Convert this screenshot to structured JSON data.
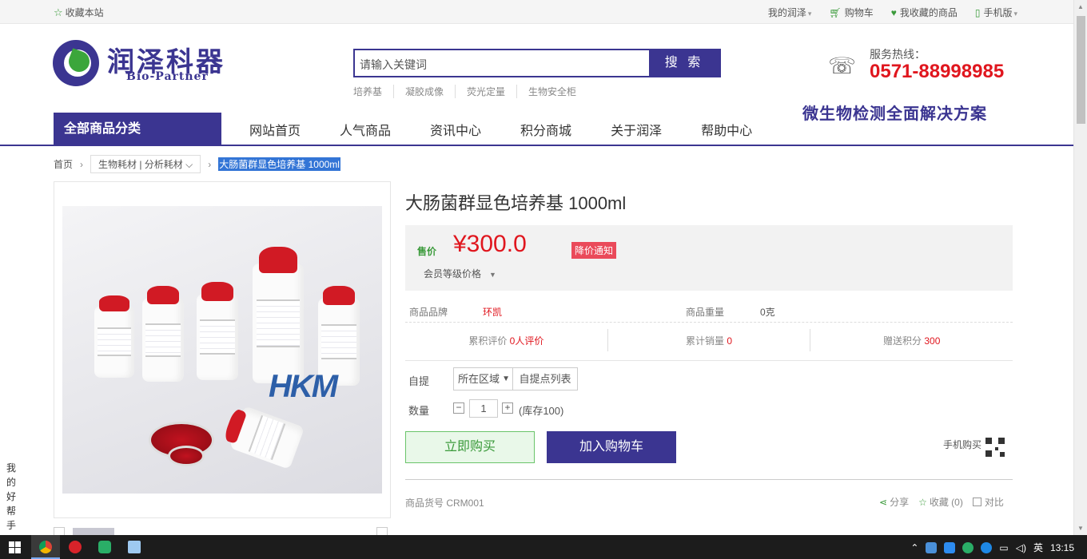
{
  "topbar": {
    "favorite": "收藏本站",
    "links": [
      {
        "label": "我的润泽",
        "icon": "",
        "dropdown": true
      },
      {
        "label": "购物车",
        "icon": "cart-icon",
        "dropdown": false
      },
      {
        "label": "我收藏的商品",
        "icon": "heart-icon",
        "dropdown": false
      },
      {
        "label": "手机版",
        "icon": "phone-icon",
        "dropdown": true
      }
    ]
  },
  "logo": {
    "cn": "润泽科器",
    "en": "Bio-Partner"
  },
  "search": {
    "placeholder": "请输入关键词",
    "button": "搜 索",
    "hot": [
      "培养基",
      "凝胶成像",
      "荧光定量",
      "生物安全柜"
    ]
  },
  "hotline": {
    "label": "服务热线：",
    "number": "0571-88998985"
  },
  "slogan": "微生物检测全面解决方案",
  "nav": {
    "category": "全部商品分类",
    "items": [
      "网站首页",
      "人气商品",
      "资讯中心",
      "积分商城",
      "关于润泽",
      "帮助中心"
    ]
  },
  "breadcrumb": {
    "home": "首页",
    "category": "生物耗材 | 分析耗材",
    "current": "大肠菌群显色培养基 1000ml"
  },
  "product": {
    "image_brand_text": "HKM",
    "title": "大肠菌群显色培养基 1000ml",
    "price_label": "售价",
    "price": "¥300.0",
    "price_notice": "降价通知",
    "member_price": "会员等级价格",
    "brand_label": "商品品牌",
    "brand": "环凯",
    "weight_label": "商品重量",
    "weight": "0克",
    "stats": [
      {
        "label": "累积评价",
        "value": "0人评价"
      },
      {
        "label": "累计销量",
        "value": "0"
      },
      {
        "label": "赠送积分",
        "value": "300"
      }
    ],
    "pickup_label": "自提",
    "region_select": "所在区域",
    "pickup_list": "自提点列表",
    "qty_label": "数量",
    "qty_value": "1",
    "stock": "(库存100)",
    "buy_now": "立即购买",
    "add_cart": "加入购物车",
    "mobile_buy": "手机购买",
    "sku": "商品货号 CRM001",
    "share": "分享",
    "collect": "收藏 (0)",
    "compare": "对比"
  },
  "side_helper": [
    "我",
    "的",
    "好",
    "帮",
    "手"
  ],
  "taskbar": {
    "ime": "英",
    "time": "13:15"
  },
  "colors": {
    "brand": "#3b3591",
    "price": "#e0161e",
    "green": "#3a9a3a"
  }
}
